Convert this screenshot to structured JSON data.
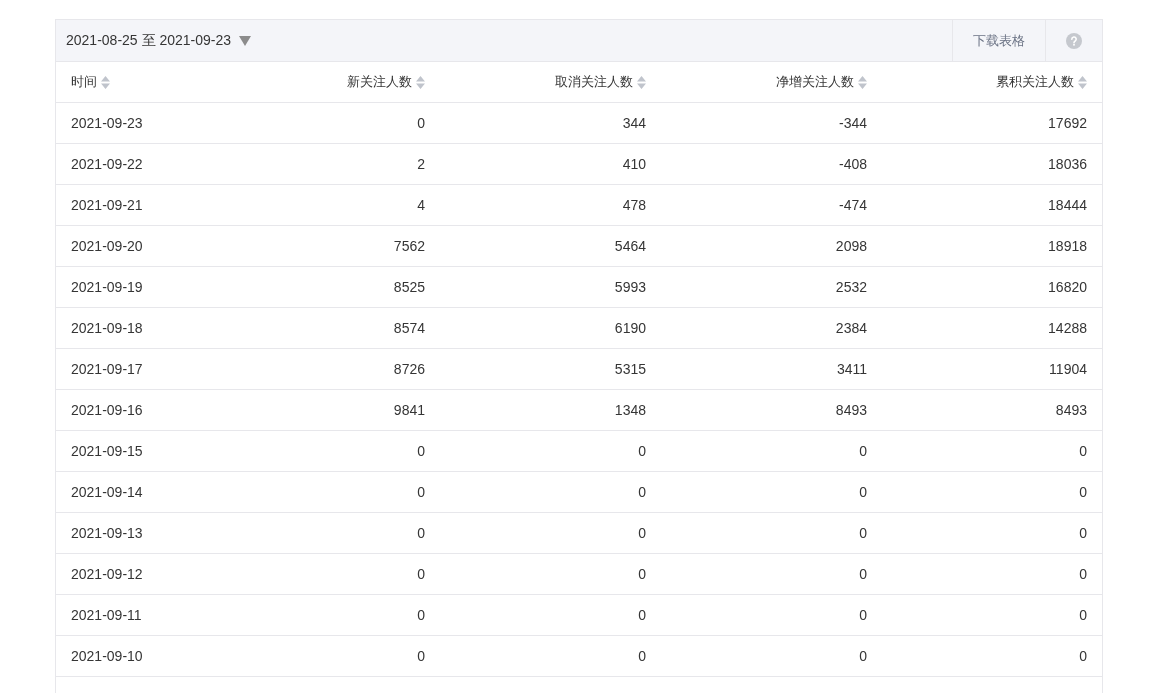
{
  "toolbar": {
    "date_range": "2021-08-25 至 2021-09-23",
    "download_button": "下载表格"
  },
  "table": {
    "columns": [
      "时间",
      "新关注人数",
      "取消关注人数",
      "净增关注人数",
      "累积关注人数"
    ],
    "rows": [
      [
        "2021-09-23",
        "0",
        "344",
        "-344",
        "17692"
      ],
      [
        "2021-09-22",
        "2",
        "410",
        "-408",
        "18036"
      ],
      [
        "2021-09-21",
        "4",
        "478",
        "-474",
        "18444"
      ],
      [
        "2021-09-20",
        "7562",
        "5464",
        "2098",
        "18918"
      ],
      [
        "2021-09-19",
        "8525",
        "5993",
        "2532",
        "16820"
      ],
      [
        "2021-09-18",
        "8574",
        "6190",
        "2384",
        "14288"
      ],
      [
        "2021-09-17",
        "8726",
        "5315",
        "3411",
        "11904"
      ],
      [
        "2021-09-16",
        "9841",
        "1348",
        "8493",
        "8493"
      ],
      [
        "2021-09-15",
        "0",
        "0",
        "0",
        "0"
      ],
      [
        "2021-09-14",
        "0",
        "0",
        "0",
        "0"
      ],
      [
        "2021-09-13",
        "0",
        "0",
        "0",
        "0"
      ],
      [
        "2021-09-12",
        "0",
        "0",
        "0",
        "0"
      ],
      [
        "2021-09-11",
        "0",
        "0",
        "0",
        "0"
      ],
      [
        "2021-09-10",
        "0",
        "0",
        "0",
        "0"
      ]
    ]
  }
}
